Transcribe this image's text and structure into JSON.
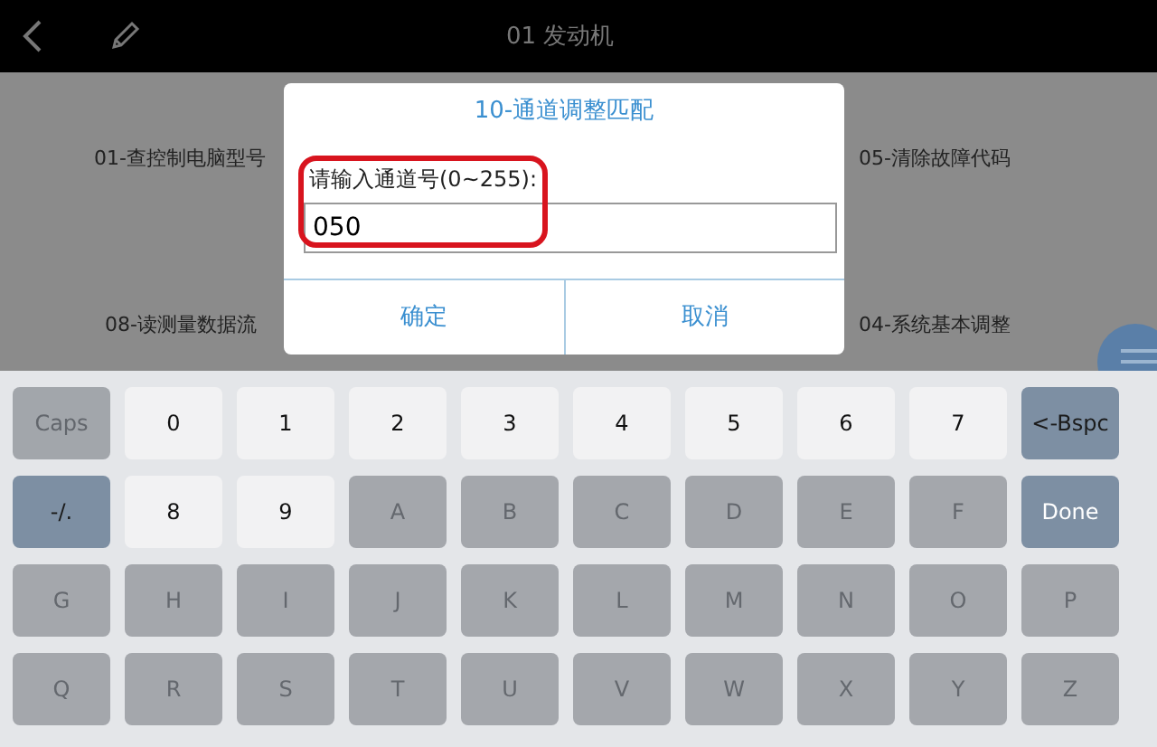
{
  "top_bar": {
    "title": "01 发动机"
  },
  "menu_items": [
    {
      "label": "01-查控制电脑型号"
    },
    {
      "label": "05-清除故障代码"
    },
    {
      "label": "08-读测量数据流"
    },
    {
      "label": "04-系统基本调整"
    }
  ],
  "dialog": {
    "title": "10-通道调整匹配",
    "prompt": "请输入通道号(0~255):",
    "value": "050",
    "highlighted": true,
    "buttons": [
      "确定",
      "取消"
    ]
  },
  "keyboard": {
    "rows": [
      [
        {
          "label": "Caps",
          "kind": "fn",
          "disabled": true
        },
        {
          "label": "0",
          "kind": "char",
          "disabled": false
        },
        {
          "label": "1",
          "kind": "char",
          "disabled": false
        },
        {
          "label": "2",
          "kind": "char",
          "disabled": false
        },
        {
          "label": "3",
          "kind": "char",
          "disabled": false
        },
        {
          "label": "4",
          "kind": "char",
          "disabled": false
        },
        {
          "label": "5",
          "kind": "char",
          "disabled": false
        },
        {
          "label": "6",
          "kind": "char",
          "disabled": false
        },
        {
          "label": "7",
          "kind": "char",
          "disabled": false
        },
        {
          "label": "<-Bspc",
          "kind": "fn",
          "disabled": false
        }
      ],
      [
        {
          "label": "-/.",
          "kind": "fn",
          "disabled": false
        },
        {
          "label": "8",
          "kind": "char",
          "disabled": false
        },
        {
          "label": "9",
          "kind": "char",
          "disabled": false
        },
        {
          "label": "A",
          "kind": "char",
          "disabled": true
        },
        {
          "label": "B",
          "kind": "char",
          "disabled": true
        },
        {
          "label": "C",
          "kind": "char",
          "disabled": true
        },
        {
          "label": "D",
          "kind": "char",
          "disabled": true
        },
        {
          "label": "E",
          "kind": "char",
          "disabled": true
        },
        {
          "label": "F",
          "kind": "char",
          "disabled": true
        },
        {
          "label": "Done",
          "kind": "fn",
          "disabled": false
        }
      ],
      [
        {
          "label": "G",
          "kind": "char",
          "disabled": true
        },
        {
          "label": "H",
          "kind": "char",
          "disabled": true
        },
        {
          "label": "I",
          "kind": "char",
          "disabled": true
        },
        {
          "label": "J",
          "kind": "char",
          "disabled": true
        },
        {
          "label": "K",
          "kind": "char",
          "disabled": true
        },
        {
          "label": "L",
          "kind": "char",
          "disabled": true
        },
        {
          "label": "M",
          "kind": "char",
          "disabled": true
        },
        {
          "label": "N",
          "kind": "char",
          "disabled": true
        },
        {
          "label": "O",
          "kind": "char",
          "disabled": true
        },
        {
          "label": "P",
          "kind": "char",
          "disabled": true
        }
      ],
      [
        {
          "label": "Q",
          "kind": "char",
          "disabled": true
        },
        {
          "label": "R",
          "kind": "char",
          "disabled": true
        },
        {
          "label": "S",
          "kind": "char",
          "disabled": true
        },
        {
          "label": "T",
          "kind": "char",
          "disabled": true
        },
        {
          "label": "U",
          "kind": "char",
          "disabled": true
        },
        {
          "label": "V",
          "kind": "char",
          "disabled": true
        },
        {
          "label": "W",
          "kind": "char",
          "disabled": true
        },
        {
          "label": "X",
          "kind": "char",
          "disabled": true
        },
        {
          "label": "Y",
          "kind": "char",
          "disabled": true
        },
        {
          "label": "Z",
          "kind": "char",
          "disabled": true
        }
      ]
    ]
  }
}
